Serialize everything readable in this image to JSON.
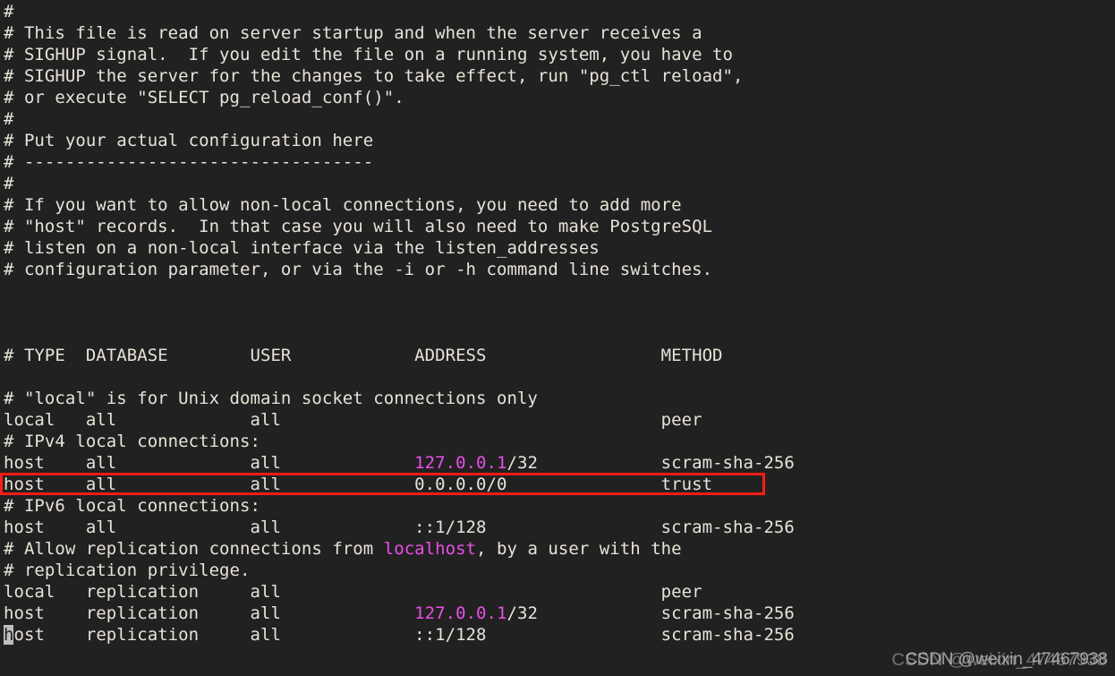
{
  "terminal": {
    "background_color": "#212121",
    "foreground_color": "#e8e3d8",
    "accent_magenta": "#ea4ee8",
    "highlight_border_color": "#fc1b16",
    "cursor_color": "#bfbfbf",
    "file_kind": "pg_hba.conf"
  },
  "lines": [
    {
      "id": 1,
      "text": "#"
    },
    {
      "id": 2,
      "text": "# This file is read on server startup and when the server receives a"
    },
    {
      "id": 3,
      "text": "# SIGHUP signal.  If you edit the file on a running system, you have to"
    },
    {
      "id": 4,
      "text": "# SIGHUP the server for the changes to take effect, run \"pg_ctl reload\","
    },
    {
      "id": 5,
      "text": "# or execute \"SELECT pg_reload_conf()\"."
    },
    {
      "id": 6,
      "text": "#"
    },
    {
      "id": 7,
      "text": "# Put your actual configuration here"
    },
    {
      "id": 8,
      "text": "# ----------------------------------"
    },
    {
      "id": 9,
      "text": "#"
    },
    {
      "id": 10,
      "text": "# If you want to allow non-local connections, you need to add more"
    },
    {
      "id": 11,
      "text": "# \"host\" records.  In that case you will also need to make PostgreSQL"
    },
    {
      "id": 12,
      "text": "# listen on a non-local interface via the listen_addresses"
    },
    {
      "id": 13,
      "text": "# configuration parameter, or via the -i or -h command line switches."
    },
    {
      "id": 14,
      "text": ""
    },
    {
      "id": 15,
      "text": ""
    },
    {
      "id": 16,
      "text": ""
    },
    {
      "id": 17,
      "text": "# TYPE  DATABASE        USER            ADDRESS                 METHOD"
    },
    {
      "id": 18,
      "text": ""
    },
    {
      "id": 19,
      "text": "# \"local\" is for Unix domain socket connections only"
    },
    {
      "id": 20,
      "text": "local   all             all                                     peer"
    },
    {
      "id": 21,
      "text": "# IPv4 local connections:"
    },
    {
      "id": 22,
      "segments": [
        {
          "text": "host    all             all             ",
          "style": "plain"
        },
        {
          "text": "127.0.0.1",
          "style": "magenta"
        },
        {
          "text": "/32            scram-sha-256",
          "style": "plain"
        }
      ]
    },
    {
      "id": 23,
      "text": "host    all             all             0.0.0.0/0               trust",
      "boxed": true
    },
    {
      "id": 24,
      "text": "# IPv6 local connections:"
    },
    {
      "id": 25,
      "text": "host    all             all             ::1/128                 scram-sha-256"
    },
    {
      "id": 26,
      "segments": [
        {
          "text": "# Allow replication connections from ",
          "style": "plain"
        },
        {
          "text": "localhost",
          "style": "magenta"
        },
        {
          "text": ", by a user with the",
          "style": "plain"
        }
      ]
    },
    {
      "id": 27,
      "text": "# replication privilege."
    },
    {
      "id": 28,
      "text": "local   replication     all                                     peer"
    },
    {
      "id": 29,
      "segments": [
        {
          "text": "host    replication     all             ",
          "style": "plain"
        },
        {
          "text": "127.0.0.1",
          "style": "magenta"
        },
        {
          "text": "/32            scram-sha-256",
          "style": "plain"
        }
      ]
    },
    {
      "id": 30,
      "segments": [
        {
          "text": "h",
          "style": "cursor"
        },
        {
          "text": "ost    replication     all             ::1/128                 scram-sha-256",
          "style": "plain"
        }
      ]
    }
  ],
  "highlight": {
    "name": "boxed-trust-rule",
    "target_line_id": 23,
    "color": "#fc1b16"
  },
  "cursor": {
    "line_id": 30,
    "column": 0,
    "character": "h"
  },
  "watermark": {
    "text": "CSDN @weixin_47467938",
    "overlay_text": "CSDN @weixin_47467938"
  }
}
